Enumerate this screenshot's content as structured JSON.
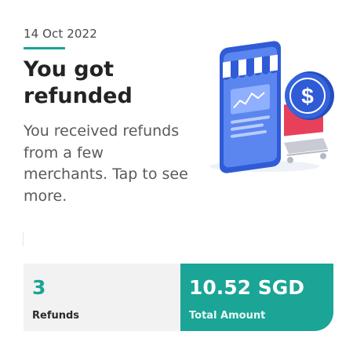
{
  "header": {
    "date": "14 Oct 2022",
    "title": "You got refunded",
    "description": "You received refunds from a few merchants. Tap to see more."
  },
  "stats": {
    "refunds_value": "3",
    "refunds_label": "Refunds",
    "amount_value": "10.52 SGD",
    "amount_label": "Total Amount"
  },
  "colors": {
    "accent": "#1aa596",
    "card_left_bg": "#f2f2f2",
    "illustration_coin": "#2e56c8",
    "illustration_cart": "#e8405a"
  },
  "illustration": {
    "icon": "phone-shop-refund-illustration",
    "coin_symbol": "$"
  }
}
